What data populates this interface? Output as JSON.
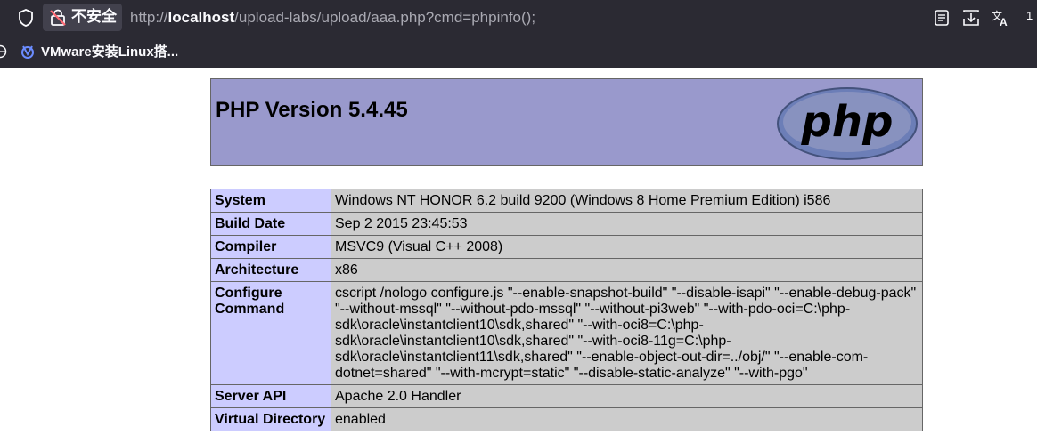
{
  "browser": {
    "security_label": "不安全",
    "url_prefix": "http://",
    "url_host": "localhost",
    "url_path": "/upload-labs/upload/aaa.php?cmd=phpinfo();",
    "edge_label": "1",
    "bookmark_label": "VMware安装Linux搭..."
  },
  "phpinfo": {
    "title": "PHP Version 5.4.45",
    "logo_text": "php",
    "rows": [
      {
        "key": "System",
        "value": "Windows NT HONOR 6.2 build 9200 (Windows 8 Home Premium Edition) i586"
      },
      {
        "key": "Build Date",
        "value": "Sep 2 2015 23:45:53"
      },
      {
        "key": "Compiler",
        "value": "MSVC9 (Visual C++ 2008)"
      },
      {
        "key": "Architecture",
        "value": "x86"
      },
      {
        "key": "Configure Command",
        "value": "cscript /nologo configure.js \"--enable-snapshot-build\" \"--disable-isapi\" \"--enable-debug-pack\" \"--without-mssql\" \"--without-pdo-mssql\" \"--without-pi3web\" \"--with-pdo-oci=C:\\php-sdk\\oracle\\instantclient10\\sdk,shared\" \"--with-oci8=C:\\php-sdk\\oracle\\instantclient10\\sdk,shared\" \"--with-oci8-11g=C:\\php-sdk\\oracle\\instantclient11\\sdk,shared\" \"--enable-object-out-dir=../obj/\" \"--enable-com-dotnet=shared\" \"--with-mcrypt=static\" \"--disable-static-analyze\" \"--with-pgo\""
      },
      {
        "key": "Server API",
        "value": "Apache 2.0 Handler"
      },
      {
        "key": "Virtual Directory",
        "value": "enabled"
      }
    ]
  }
}
